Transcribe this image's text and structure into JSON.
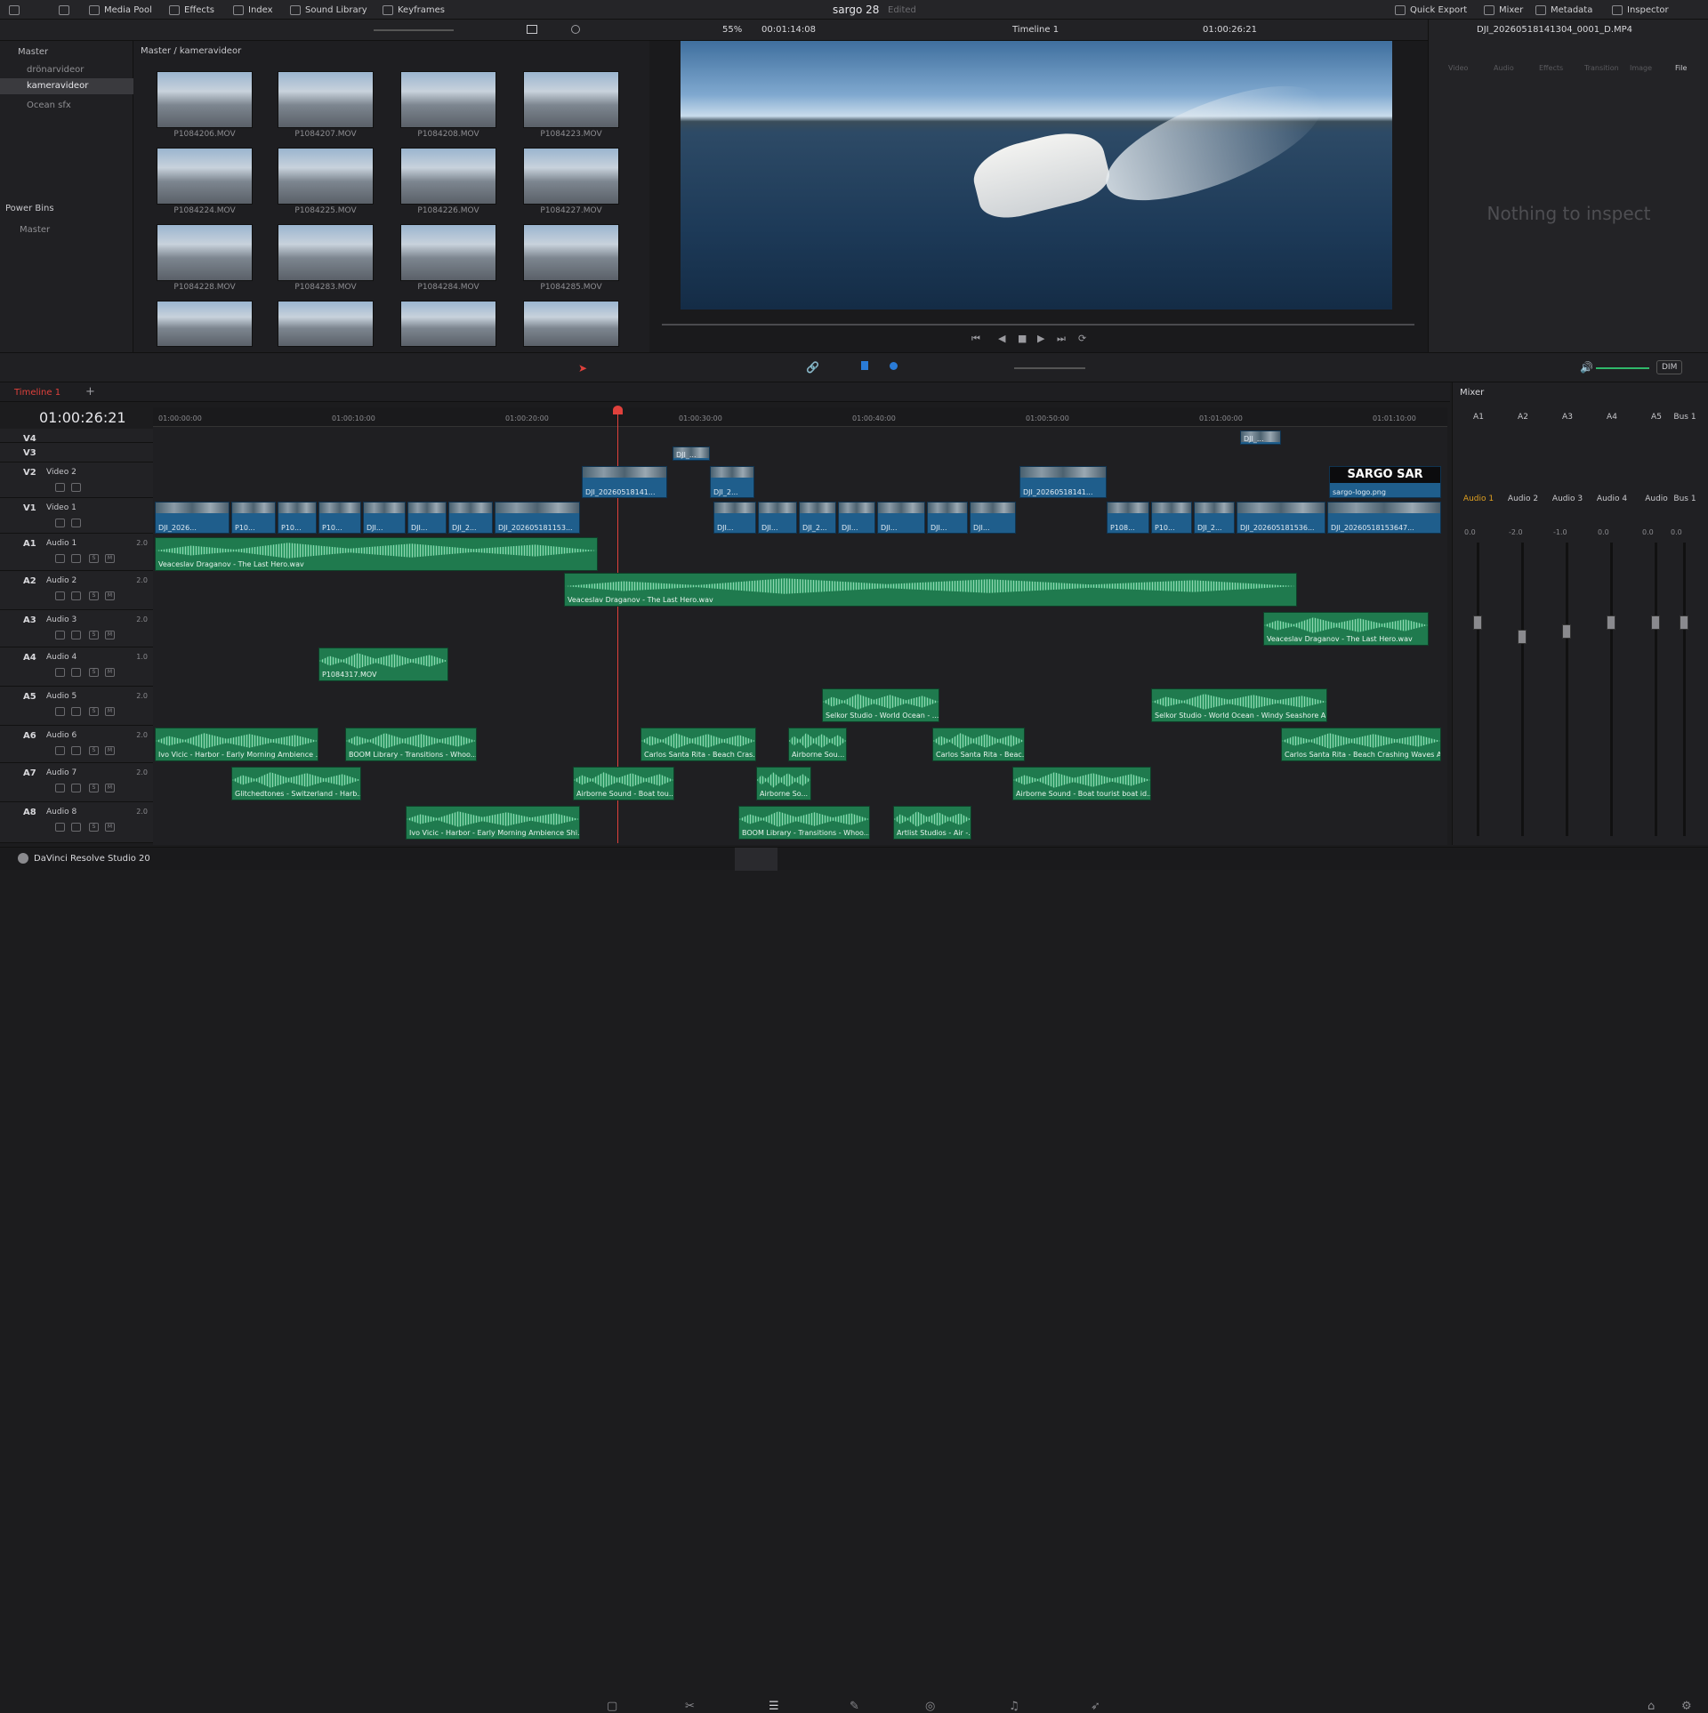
{
  "topbar": {
    "media_pool": "Media Pool",
    "effects": "Effects",
    "index": "Index",
    "sound_library": "Sound Library",
    "keyframes": "Keyframes",
    "project_title": "sargo 28",
    "project_status": "Edited",
    "quick_export": "Quick Export",
    "mixer": "Mixer",
    "metadata": "Metadata",
    "inspector": "Inspector"
  },
  "media_toolbar": {
    "zoom": "55%",
    "source_tc": "00:01:14:08",
    "timeline_name": "Timeline 1",
    "program_tc": "01:00:26:21"
  },
  "bins": {
    "master": "Master",
    "items": [
      "drönarvideor",
      "kameravideor",
      "Ocean sfx"
    ],
    "power_bins": "Power Bins",
    "power_master": "Master"
  },
  "pool": {
    "breadcrumb": "Master / kameravideor",
    "clips": [
      "P1084206.MOV",
      "P1084207.MOV",
      "P1084208.MOV",
      "P1084223.MOV",
      "P1084224.MOV",
      "P1084225.MOV",
      "P1084226.MOV",
      "P1084227.MOV",
      "P1084228.MOV",
      "P1084283.MOV",
      "P1084284.MOV",
      "P1084285.MOV"
    ]
  },
  "inspector": {
    "clip_name": "DJI_20260518141304_0001_D.MP4",
    "tabs": [
      "Video",
      "Audio",
      "Effects",
      "Transition",
      "Image",
      "File"
    ],
    "empty": "Nothing to inspect"
  },
  "timeline": {
    "tab": "Timeline 1",
    "timecode": "01:00:26:21",
    "ruler": [
      "01:00:00:00",
      "01:00:10:00",
      "01:00:20:00",
      "01:00:30:00",
      "01:00:40:00",
      "01:00:50:00",
      "01:01:00:00",
      "01:01:10:00"
    ],
    "dim": "DIM"
  },
  "tracks": [
    {
      "id": "V4",
      "name": "",
      "vol": ""
    },
    {
      "id": "V3",
      "name": "",
      "vol": ""
    },
    {
      "id": "V2",
      "name": "Video 2",
      "vol": ""
    },
    {
      "id": "V1",
      "name": "Video 1",
      "vol": ""
    },
    {
      "id": "A1",
      "name": "Audio 1",
      "vol": "2.0"
    },
    {
      "id": "A2",
      "name": "Audio 2",
      "vol": "2.0"
    },
    {
      "id": "A3",
      "name": "Audio 3",
      "vol": "2.0"
    },
    {
      "id": "A4",
      "name": "Audio 4",
      "vol": "1.0"
    },
    {
      "id": "A5",
      "name": "Audio 5",
      "vol": "2.0"
    },
    {
      "id": "A6",
      "name": "Audio 6",
      "vol": "2.0"
    },
    {
      "id": "A7",
      "name": "Audio 7",
      "vol": "2.0"
    },
    {
      "id": "A8",
      "name": "Audio 8",
      "vol": "2.0"
    }
  ],
  "vclips": {
    "v3": "DJI_...",
    "v4": "DJI_...",
    "v2a": "DJI_20260518141...",
    "v2b": "DJI_2...",
    "v2c": "DJI_20260518141...",
    "v2logo": "sargo-logo.png",
    "logo_text": "SARGO SAR",
    "v1": [
      "DJI_2026...",
      "P10...",
      "P10...",
      "P10...",
      "DJI...",
      "DJI...",
      "DJI_2...",
      "DJI_202605181153...",
      "DJI...",
      "DJI...",
      "DJI_2...",
      "DJI...",
      "DJI...",
      "DJI...",
      "DJI...",
      "P108...",
      "P10...",
      "DJI_2...",
      "DJI_202605181536...",
      "DJI_20260518153647..."
    ]
  },
  "aclips": {
    "a1": "Veaceslav Draganov - The Last Hero.wav",
    "a2": "Veaceslav Draganov - The Last Hero.wav",
    "a3": "Veaceslav Draganov - The Last Hero.wav",
    "a4": "P1084317.MOV",
    "a5a": "Selkor Studio - World Ocean - ...",
    "a5b": "Selkor Studio - World Ocean - Windy Seashore A...",
    "a6a": "Ivo Vicic - Harbor - Early Morning Ambience ...",
    "a6b": "BOOM Library - Transitions - Whoo...",
    "a6c": "Carlos Santa Rita - Beach Cras...",
    "a6d": "Airborne Sou...",
    "a6e": "Carlos Santa Rita - Beac...",
    "a6f": "Carlos Santa Rita - Beach Crashing Waves A...",
    "a7a": "Glitchedtones - Switzerland - Harb...",
    "a7b": "Airborne Sound - Boat tou...",
    "a7c": "Airborne So...",
    "a7d": "Airborne Sound - Boat tourist boat id...",
    "a8a": "Ivo Vicic - Harbor - Early Morning Ambience Shi...",
    "a8b": "BOOM Library - Transitions - Whoo...",
    "a8c": "Artlist Studios - Air -..."
  },
  "mixer": {
    "title": "Mixer",
    "channels": [
      "A1",
      "A2",
      "A3",
      "A4",
      "A5",
      "Bus 1"
    ],
    "names": [
      "Audio 1",
      "Audio 2",
      "Audio 3",
      "Audio 4",
      "Audio",
      "Bus 1"
    ],
    "levels": [
      "0.0",
      "-2.0",
      "-1.0",
      "0.0",
      "0.0",
      "0.0"
    ]
  },
  "footer": {
    "app": "DaVinci Resolve Studio 20"
  },
  "colors": {
    "accent": "#e0413c",
    "video_clip": "#1f5e8c",
    "audio_clip": "#1f7a4e",
    "selected_bin": "#3a3a3e"
  }
}
